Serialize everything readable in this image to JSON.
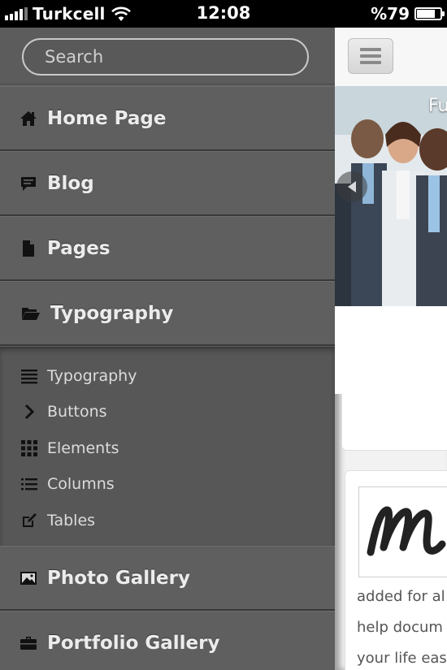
{
  "status_bar": {
    "carrier": "Turkcell",
    "time": "12:08",
    "battery_text": "%79",
    "battery_level": 0.79
  },
  "search": {
    "placeholder": "Search"
  },
  "menu": {
    "items": [
      {
        "label": "Home Page",
        "icon": "home-icon"
      },
      {
        "label": "Blog",
        "icon": "chat-bubble-icon"
      },
      {
        "label": "Pages",
        "icon": "document-icon"
      },
      {
        "label": "Typography",
        "icon": "folder-open-icon"
      },
      {
        "label": "Photo Gallery",
        "icon": "picture-icon"
      },
      {
        "label": "Portfolio Gallery",
        "icon": "briefcase-icon"
      }
    ],
    "submenu": [
      {
        "label": "Typography",
        "icon": "align-justify-icon"
      },
      {
        "label": "Buttons",
        "icon": "chevron-right-icon"
      },
      {
        "label": "Elements",
        "icon": "grid-icon"
      },
      {
        "label": "Columns",
        "icon": "list-icon"
      },
      {
        "label": "Tables",
        "icon": "edit-icon"
      }
    ]
  },
  "main": {
    "hero_title": "Fu",
    "content_lines": [
      "added for al",
      "help docum",
      "your life eas"
    ],
    "logo_letter": "M"
  },
  "colors": {
    "menu_bg": "#5f5f5f",
    "submenu_bg": "#575757",
    "menu_text": "#ececec",
    "status_bar_bg": "#000000"
  }
}
